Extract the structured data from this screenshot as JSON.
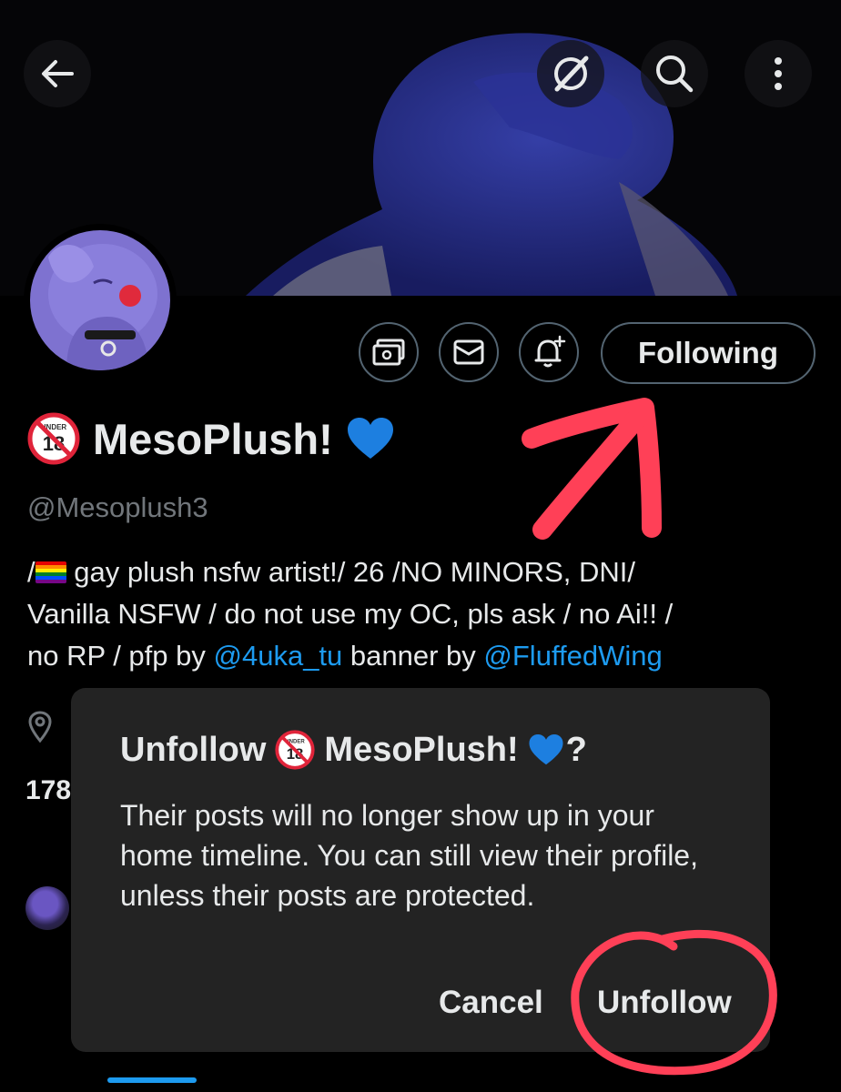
{
  "profile": {
    "display_name": "MesoPlush!",
    "handle": "@Mesoplush3",
    "following_label": "Following",
    "bio": {
      "line1_prefix": "/",
      "line1_text": " gay plush nsfw artist!/ 26 /NO MINORS, DNI/",
      "line2": "Vanilla NSFW / do not use my OC, pls ask / no Ai!! /",
      "line3_pre": "no RP / pfp by ",
      "line3_link1": "@4uka_tu",
      "line3_mid": " banner by ",
      "line3_link2": "@FluffedWing"
    },
    "count_partial": "178"
  },
  "dialog": {
    "title_prefix": "Unfollow",
    "title_name": "MesoPlush!",
    "title_suffix": "?",
    "body": "Their posts will no longer show up in your home timeline. You can still view their profile, unless their posts are protected.",
    "cancel_label": "Cancel",
    "unfollow_label": "Unfollow"
  },
  "badge_text": "UNDER",
  "badge_number": "18",
  "icons": [
    "back-arrow-icon",
    "grok-icon",
    "search-icon",
    "more-options-icon",
    "subscribe-icon",
    "message-icon",
    "notification-add-icon",
    "location-icon",
    "heart-icon"
  ],
  "colors": {
    "background": "#000000",
    "text": "#e7e9ea",
    "muted": "#71767b",
    "link": "#1d9bf0",
    "dialog": "#232323",
    "annotation": "#ff4057"
  }
}
